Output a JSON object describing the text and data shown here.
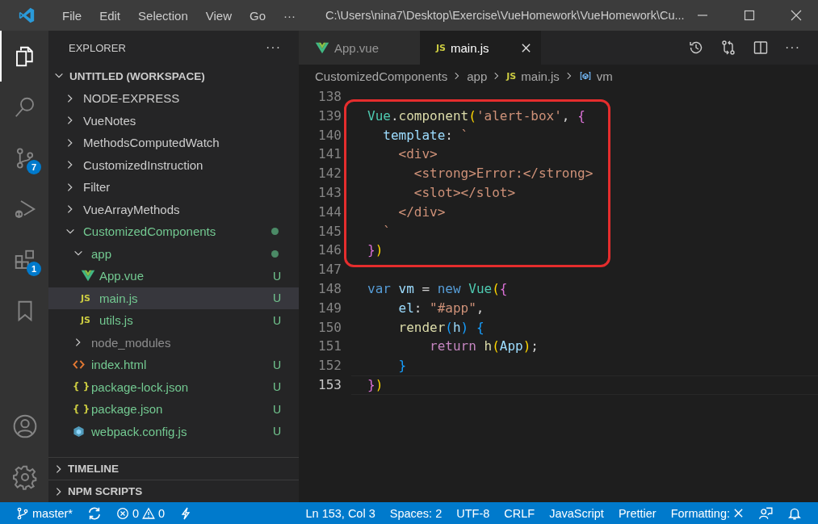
{
  "title_bar": {
    "menus": [
      "File",
      "Edit",
      "Selection",
      "View",
      "Go",
      "···"
    ],
    "title": "C:\\Users\\nina7\\Desktop\\Exercise\\VueHomework\\VueHomework\\Cu..."
  },
  "activity_bar": {
    "top": [
      {
        "kind": "explorer",
        "selected": true
      },
      {
        "kind": "search",
        "selected": false
      },
      {
        "kind": "source-control",
        "selected": false,
        "badge": "7"
      },
      {
        "kind": "run-debug",
        "selected": false
      },
      {
        "kind": "extensions",
        "selected": false,
        "badge": "1"
      },
      {
        "kind": "bookmarks",
        "selected": false
      }
    ],
    "bottom": [
      {
        "kind": "account",
        "selected": false
      },
      {
        "kind": "settings",
        "selected": false
      }
    ]
  },
  "sidebar": {
    "title": "EXPLORER",
    "more": "···",
    "workspace": {
      "label": "UNTITLED (WORKSPACE)",
      "expanded": true
    },
    "tree": [
      {
        "label": "NODE-EXPRESS",
        "kind": "folder",
        "expanded": false,
        "untracked": false,
        "ignored": false,
        "dot": false,
        "selected": false
      },
      {
        "label": "VueNotes",
        "kind": "folder",
        "expanded": false,
        "untracked": false,
        "ignored": false,
        "dot": false,
        "selected": false
      },
      {
        "label": "MethodsComputedWatch",
        "kind": "folder",
        "expanded": false,
        "untracked": false,
        "ignored": false,
        "dot": false,
        "selected": false
      },
      {
        "label": "CustomizedInstruction",
        "kind": "folder",
        "expanded": false,
        "untracked": false,
        "ignored": false,
        "dot": false,
        "selected": false
      },
      {
        "label": "Filter",
        "kind": "folder",
        "expanded": false,
        "untracked": false,
        "ignored": false,
        "dot": false,
        "selected": false
      },
      {
        "label": "VueArrayMethods",
        "kind": "folder",
        "expanded": false,
        "untracked": false,
        "ignored": false,
        "dot": false,
        "selected": false
      },
      {
        "label": "CustomizedComponents",
        "kind": "folder",
        "expanded": true,
        "untracked": true,
        "ignored": false,
        "dot": true,
        "selected": false,
        "children": [
          {
            "label": "app",
            "kind": "folder",
            "expanded": true,
            "untracked": true,
            "ignored": false,
            "dot": true,
            "selected": false,
            "children": [
              {
                "label": "App.vue",
                "kind": "vue",
                "untracked": true,
                "ignored": false,
                "badge": "U",
                "selected": false
              },
              {
                "label": "main.js",
                "kind": "js",
                "icon_label": "JS",
                "untracked": true,
                "ignored": false,
                "badge": "U",
                "selected": true
              },
              {
                "label": "utils.js",
                "kind": "js",
                "icon_label": "JS",
                "untracked": true,
                "ignored": false,
                "badge": "U",
                "selected": false
              }
            ]
          },
          {
            "label": "node_modules",
            "kind": "folder",
            "expanded": false,
            "untracked": false,
            "ignored": true,
            "dot": false,
            "selected": false
          },
          {
            "label": "index.html",
            "kind": "html",
            "untracked": true,
            "ignored": false,
            "badge": "U",
            "selected": false
          },
          {
            "label": "package-lock.json",
            "kind": "json",
            "icon_label": "{ }",
            "untracked": true,
            "ignored": false,
            "badge": "U",
            "selected": false
          },
          {
            "label": "package.json",
            "kind": "json",
            "icon_label": "{ }",
            "untracked": true,
            "ignored": false,
            "badge": "U",
            "selected": false
          },
          {
            "label": "webpack.config.js",
            "kind": "webpack",
            "untracked": true,
            "ignored": false,
            "badge": "U",
            "selected": false
          }
        ]
      }
    ],
    "sections": [
      {
        "label": "TIMELINE",
        "expanded": false
      },
      {
        "label": "NPM SCRIPTS",
        "expanded": false
      }
    ]
  },
  "tabs": [
    {
      "label": "App.vue",
      "kind": "vue",
      "selected": false
    },
    {
      "label": "main.js",
      "kind": "js",
      "icon_label": "JS",
      "selected": true
    }
  ],
  "editor_actions_more": "···",
  "breadcrumbs": [
    {
      "label": "CustomizedComponents",
      "kind": "folder"
    },
    {
      "label": "app",
      "kind": "folder"
    },
    {
      "label": "main.js",
      "kind": "js",
      "icon_label": "JS"
    },
    {
      "label": "vm",
      "kind": "variable"
    }
  ],
  "editor": {
    "blocks": [
      {
        "highlighted": false,
        "lines": [
          {
            "number": "138",
            "current": false
          }
        ]
      },
      {
        "highlighted": true,
        "lines": [
          {
            "number": "139",
            "current": false,
            "tokens": [
              {
                "text": "Vue",
                "kind": "class"
              },
              {
                "text": ".",
                "kind": "punct"
              },
              {
                "text": "component",
                "kind": "func"
              },
              {
                "text": "(",
                "kind": "bracket1"
              },
              {
                "text": "'alert-box'",
                "kind": "string"
              },
              {
                "text": ", ",
                "kind": "punct"
              },
              {
                "text": "{",
                "kind": "bracket2"
              }
            ]
          },
          {
            "number": "140",
            "current": false,
            "tokens": [
              {
                "text": "  template",
                "kind": "prop"
              },
              {
                "text": ": ",
                "kind": "punct"
              },
              {
                "text": "`",
                "kind": "string"
              }
            ]
          },
          {
            "number": "141",
            "current": false,
            "tokens": [
              {
                "text": "    <div>",
                "kind": "string"
              }
            ]
          },
          {
            "number": "142",
            "current": false,
            "tokens": [
              {
                "text": "      <strong>Error:</strong>",
                "kind": "string"
              }
            ]
          },
          {
            "number": "143",
            "current": false,
            "tokens": [
              {
                "text": "      <slot></slot>",
                "kind": "string"
              }
            ]
          },
          {
            "number": "144",
            "current": false,
            "tokens": [
              {
                "text": "    </div>",
                "kind": "string"
              }
            ]
          },
          {
            "number": "145",
            "current": false,
            "tokens": [
              {
                "text": "  `",
                "kind": "string"
              }
            ]
          },
          {
            "number": "146",
            "current": false,
            "tokens": [
              {
                "text": "}",
                "kind": "bracket2"
              },
              {
                "text": ")",
                "kind": "bracket1"
              }
            ]
          }
        ]
      },
      {
        "highlighted": false,
        "lines": [
          {
            "number": "147",
            "current": false
          },
          {
            "number": "148",
            "current": false,
            "tokens": [
              {
                "text": "var",
                "kind": "keyword"
              },
              {
                "text": " vm",
                "kind": "var"
              },
              {
                "text": " = ",
                "kind": "punct"
              },
              {
                "text": "new",
                "kind": "keyword"
              },
              {
                "text": " Vue",
                "kind": "class"
              },
              {
                "text": "(",
                "kind": "bracket1"
              },
              {
                "text": "{",
                "kind": "bracket2"
              }
            ]
          },
          {
            "number": "149",
            "current": false,
            "tokens": [
              {
                "text": "    el",
                "kind": "prop"
              },
              {
                "text": ": ",
                "kind": "punct"
              },
              {
                "text": "\"#app\"",
                "kind": "string"
              },
              {
                "text": ",",
                "kind": "punct"
              }
            ]
          },
          {
            "number": "150",
            "current": false,
            "tokens": [
              {
                "text": "    render",
                "kind": "func"
              },
              {
                "text": "(",
                "kind": "bracket3"
              },
              {
                "text": "h",
                "kind": "var"
              },
              {
                "text": ")",
                "kind": "bracket3"
              },
              {
                "text": " {",
                "kind": "bracket3"
              }
            ]
          },
          {
            "number": "151",
            "current": false,
            "tokens": [
              {
                "text": "        return",
                "kind": "control"
              },
              {
                "text": " h",
                "kind": "func"
              },
              {
                "text": "(",
                "kind": "bracket1"
              },
              {
                "text": "App",
                "kind": "var"
              },
              {
                "text": ")",
                "kind": "bracket1"
              },
              {
                "text": ";",
                "kind": "punct"
              }
            ]
          },
          {
            "number": "152",
            "current": false,
            "tokens": [
              {
                "text": "    }",
                "kind": "bracket3"
              }
            ]
          },
          {
            "number": "153",
            "current": true,
            "tokens": [
              {
                "text": "}",
                "kind": "bracket2"
              },
              {
                "text": ")",
                "kind": "bracket1"
              }
            ]
          }
        ]
      }
    ]
  },
  "status_bar": {
    "branch": "master*",
    "errors": "0",
    "warnings": "0",
    "right": [
      {
        "label": "Ln 153, Col 3",
        "kind": "text"
      },
      {
        "label": "Spaces: 2",
        "kind": "text"
      },
      {
        "label": "UTF-8",
        "kind": "text"
      },
      {
        "label": "CRLF",
        "kind": "text"
      },
      {
        "label": "JavaScript",
        "kind": "text"
      },
      {
        "label": "Prettier",
        "kind": "text"
      },
      {
        "label": "Formatting:",
        "kind": "formatting"
      }
    ]
  }
}
